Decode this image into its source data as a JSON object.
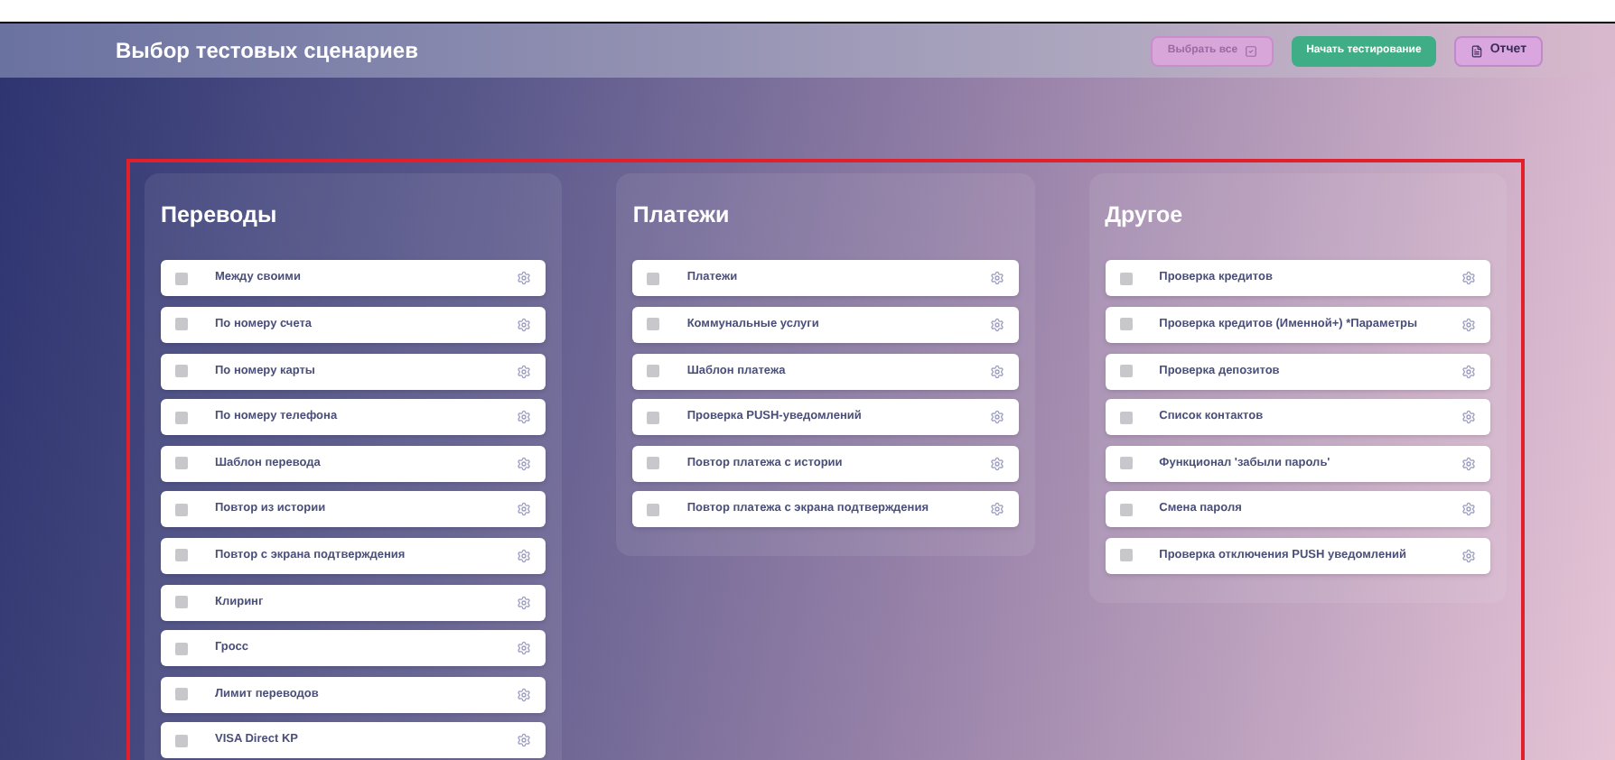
{
  "header": {
    "title": "Выбор тестовых сценариев",
    "buttons": [
      {
        "kind": "select_all",
        "label": "Выбрать все"
      },
      {
        "kind": "start",
        "label": "Начать тестирование"
      },
      {
        "kind": "report",
        "label": "Отчет"
      }
    ]
  },
  "groups": [
    {
      "title": "Переводы",
      "items": [
        {
          "label": "Между своими",
          "checked": false
        },
        {
          "label": "По номеру счета",
          "checked": false
        },
        {
          "label": "По номеру карты",
          "checked": false
        },
        {
          "label": "По номеру телефона",
          "checked": false
        },
        {
          "label": "Шаблон перевода",
          "checked": false
        },
        {
          "label": "Повтор из истории",
          "checked": false
        },
        {
          "label": "Повтор с экрана подтверждения",
          "checked": false
        },
        {
          "label": "Клиринг",
          "checked": false
        },
        {
          "label": "Гросс",
          "checked": false
        },
        {
          "label": "Лимит переводов",
          "checked": false
        },
        {
          "label": "VISA Direct KP",
          "checked": false
        }
      ]
    },
    {
      "title": "Платежи",
      "items": [
        {
          "label": "Платежи",
          "checked": false
        },
        {
          "label": "Коммунальные услуги",
          "checked": false
        },
        {
          "label": "Шаблон платежа",
          "checked": false
        },
        {
          "label": "Проверка PUSH-уведомлений",
          "checked": false
        },
        {
          "label": "Повтор платежа с истории",
          "checked": false
        },
        {
          "label": "Повтор платежа с экрана подтверждения",
          "checked": false
        }
      ]
    },
    {
      "title": "Другое",
      "items": [
        {
          "label": "Проверка кредитов",
          "checked": false
        },
        {
          "label": "Проверка кредитов (Именной+) *Параметры",
          "checked": false
        },
        {
          "label": "Проверка депозитов",
          "checked": false
        },
        {
          "label": "Список контактов",
          "checked": false
        },
        {
          "label": "Функционал 'забыли пароль'",
          "checked": false
        },
        {
          "label": "Смена пароля",
          "checked": false
        },
        {
          "label": "Проверка отключения PUSH уведомлений",
          "checked": false
        }
      ]
    }
  ]
}
